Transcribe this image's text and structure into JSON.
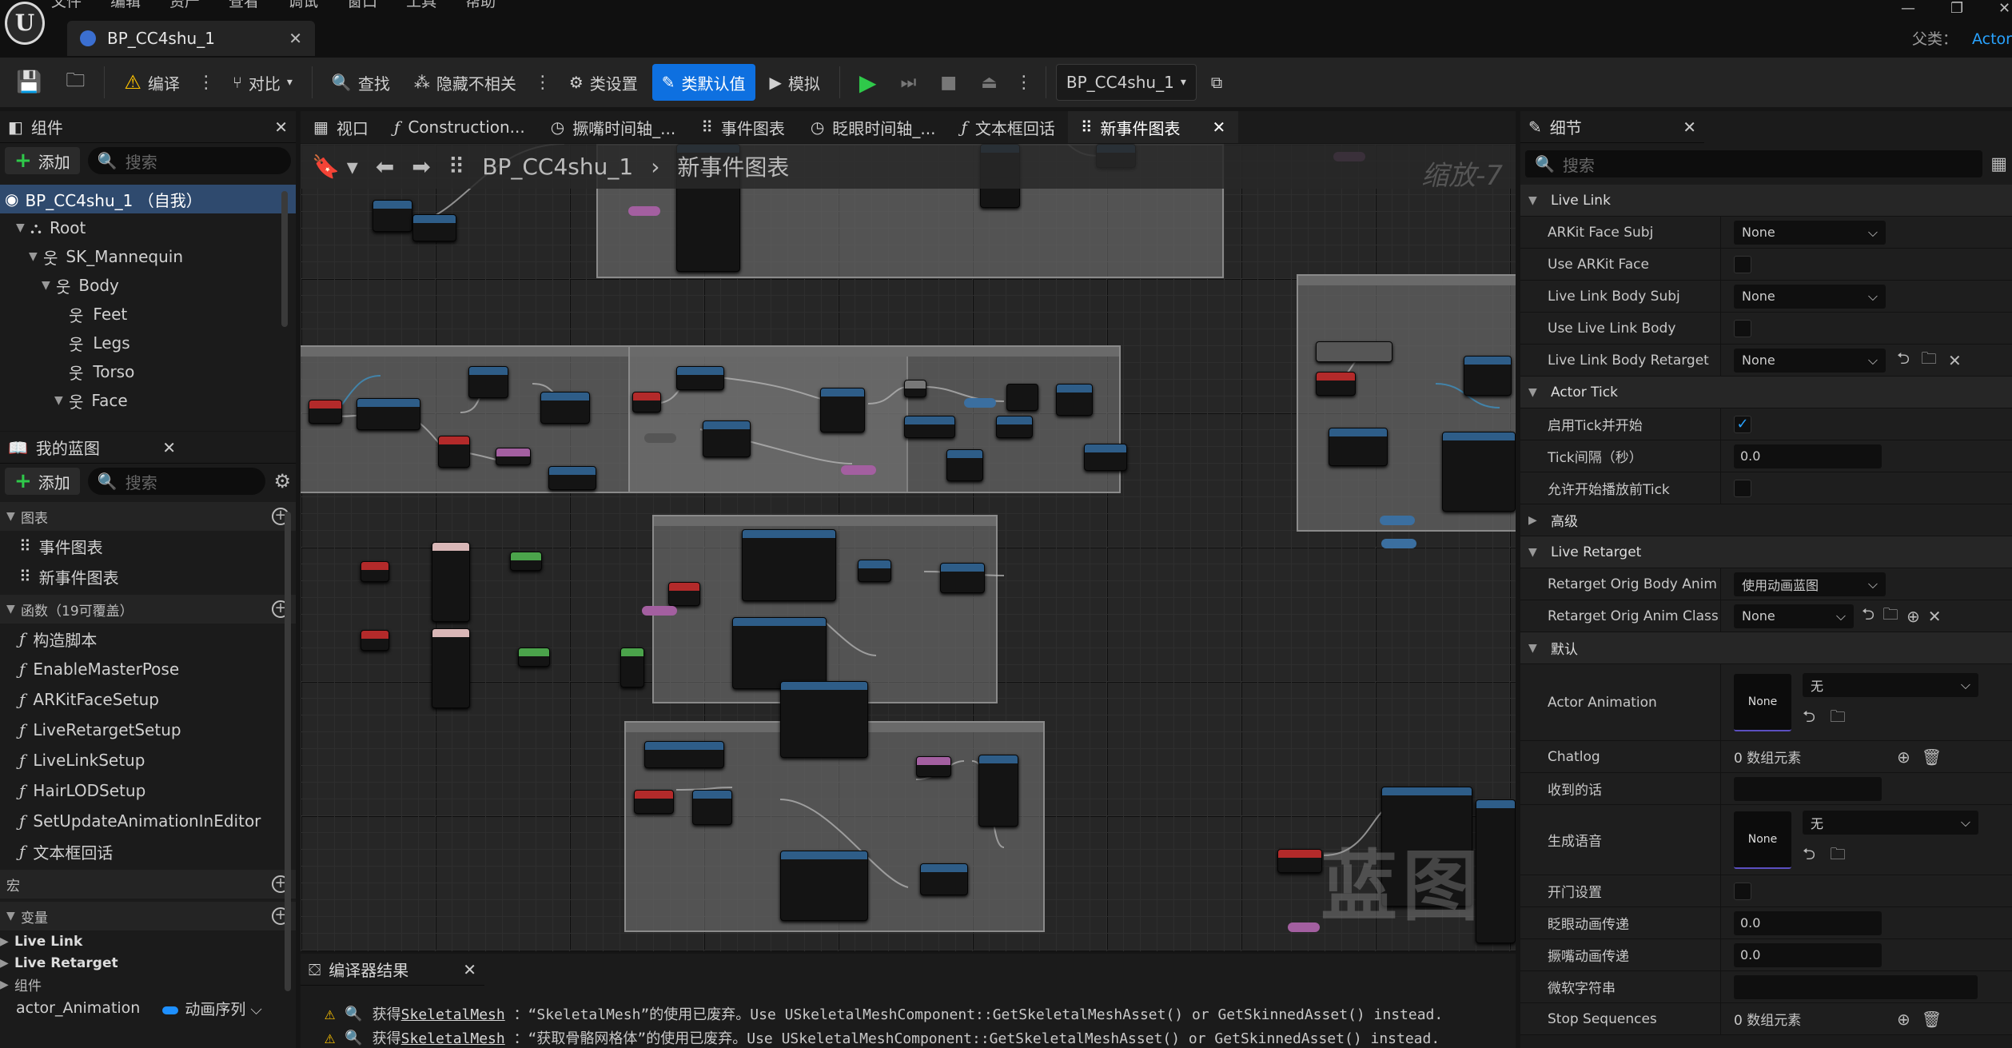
{
  "menu": [
    "文件",
    "编辑",
    "资产",
    "查看",
    "调试",
    "窗口",
    "工具",
    "帮助"
  ],
  "document_tab": "BP_CC4shu_1",
  "parent_class": {
    "label": "父类：",
    "value": "Actor"
  },
  "toolbar": {
    "compile": "编译",
    "diff": "对比",
    "find": "查找",
    "hide_unrelated": "隐藏不相关",
    "class_settings": "类设置",
    "class_defaults": "类默认值",
    "simulate": "模拟",
    "debug_object": "BP_CC4shu_1"
  },
  "components_panel": {
    "title": "组件",
    "add": "添加",
    "search_placeholder": "搜索",
    "tree": [
      {
        "label": "BP_CC4shu_1 （自我）",
        "depth": 0
      },
      {
        "label": "Root",
        "depth": 1
      },
      {
        "label": "SK_Mannequin",
        "depth": 2
      },
      {
        "label": "Body",
        "depth": 3
      },
      {
        "label": "Feet",
        "depth": 4
      },
      {
        "label": "Legs",
        "depth": 4
      },
      {
        "label": "Torso",
        "depth": 4
      },
      {
        "label": "Face",
        "depth": 3
      }
    ]
  },
  "my_blueprint": {
    "title": "我的蓝图",
    "add": "添加",
    "search_placeholder": "搜索",
    "graphs_header": "图表",
    "graphs": [
      "事件图表",
      "新事件图表"
    ],
    "functions_header": "函数（19可覆盖）",
    "functions": [
      "构造脚本",
      "EnableMasterPose",
      "ARKitFaceSetup",
      "LiveRetargetSetup",
      "LiveLinkSetup",
      "HairLODSetup",
      "SetUpdateAnimationInEditor",
      "文本框回话"
    ],
    "macros_header": "宏",
    "variables_header": "变量",
    "variable_groups": [
      "Live Link",
      "Live Retarget",
      "组件"
    ],
    "variable_row": {
      "name": "actor_Animation",
      "type": "动画序列"
    }
  },
  "graph_tabs": [
    {
      "label": "视口",
      "icon": "viewport-icon"
    },
    {
      "label": "Construction...",
      "icon": "function-icon"
    },
    {
      "label": "撅嘴时间轴_...",
      "icon": "timeline-icon"
    },
    {
      "label": "事件图表",
      "icon": "graph-icon"
    },
    {
      "label": "眨眼时间轴_...",
      "icon": "timeline-icon"
    },
    {
      "label": "文本框回话",
      "icon": "function-icon"
    },
    {
      "label": "新事件图表",
      "icon": "graph-icon"
    }
  ],
  "graph": {
    "breadcrumb_root": "BP_CC4shu_1",
    "breadcrumb_current": "新事件图表",
    "zoom": "缩放-7",
    "watermark": "蓝图"
  },
  "compiler_results": {
    "title": "编译器结果",
    "lines": [
      {
        "prefix": "获得",
        "link": "SkeletalMesh",
        "text": "：“SkeletalMesh”的使用已废弃。Use USkeletalMeshComponent::GetSkeletalMeshAsset() or GetSkinnedAsset() instead."
      },
      {
        "prefix": "获得",
        "link": "SkeletalMesh",
        "text": "：“获取骨骼网格体”的使用已废弃。Use USkeletalMeshComponent::GetSkeletalMeshAsset() or GetSkinnedAsset() instead."
      }
    ]
  },
  "details": {
    "title": "细节",
    "search_placeholder": "搜索",
    "sections": {
      "live_link": "Live Link",
      "actor_tick": "Actor Tick",
      "advanced": "高级",
      "live_retarget": "Live Retarget",
      "default": "默认"
    },
    "arkit_face_subj": {
      "label": "ARKit Face Subj",
      "value": "None"
    },
    "use_arkit_face": {
      "label": "Use ARKit Face"
    },
    "live_link_body_subj": {
      "label": "Live Link Body Subj",
      "value": "None"
    },
    "use_live_link_body": {
      "label": "Use Live Link Body"
    },
    "live_link_body_retarget": {
      "label": "Live Link Body Retarget",
      "value": "None"
    },
    "start_with_tick": {
      "label": "启用Tick并开始"
    },
    "tick_interval": {
      "label": "Tick间隔（秒）",
      "value": "0.0"
    },
    "tick_before_begin": {
      "label": "允许开始播放前Tick"
    },
    "retarget_orig_body_anim": {
      "label": "Retarget Orig Body Anim M...",
      "value": "使用动画蓝图"
    },
    "retarget_orig_anim_class": {
      "label": "Retarget Orig Anim Class",
      "value": "None"
    },
    "actor_animation": {
      "label": "Actor Animation",
      "thumb": "None",
      "value": "无"
    },
    "chatlog": {
      "label": "Chatlog",
      "value": "0 数组元素"
    },
    "received": {
      "label": "收到的话",
      "value": ""
    },
    "generated_voice": {
      "label": "生成语音",
      "thumb": "None",
      "value": "无"
    },
    "door_setting": {
      "label": "开门设置"
    },
    "blink_anim_speed": {
      "label": "眨眼动画传递",
      "value": "0.0"
    },
    "pout_anim_speed": {
      "label": "撅嘴动画传递",
      "value": "0.0"
    },
    "micro_string": {
      "label": "微软字符串",
      "value": ""
    },
    "stop_sequences": {
      "label": "Stop Sequences",
      "value": "0 数组元素"
    }
  },
  "colors": {
    "accent": "#0e70e0",
    "checkbox": "#29a3ff",
    "warning": "#ffc400",
    "link": "#29a3ff"
  }
}
